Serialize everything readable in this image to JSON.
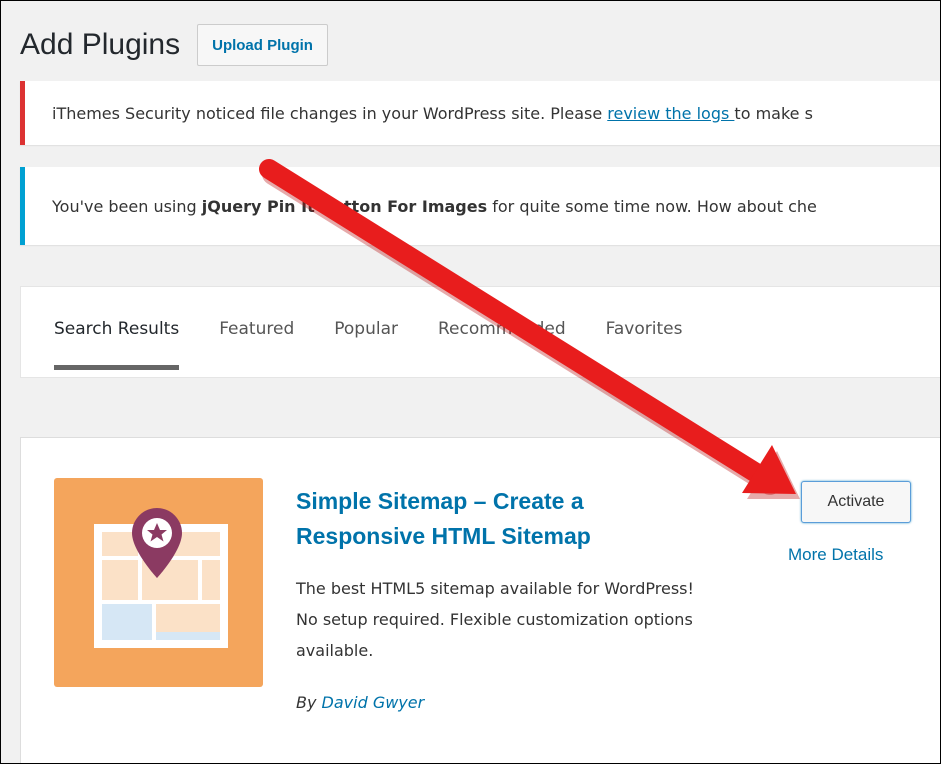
{
  "header": {
    "title": "Add Plugins",
    "upload_label": "Upload Plugin"
  },
  "notices": {
    "security": {
      "before": "iThemes Security noticed file changes in your WordPress site. Please ",
      "link": "review the logs ",
      "after": "to make s"
    },
    "pinit": {
      "before": "You've been using ",
      "plugin": "jQuery Pin It Button For Images",
      "after": " for quite some time now. How about che"
    }
  },
  "tabs": [
    "Search Results",
    "Featured",
    "Popular",
    "Recommended",
    "Favorites"
  ],
  "plugin": {
    "name": "Simple Sitemap – Create a Responsive HTML Sitemap",
    "description": "The best HTML5 sitemap available for WordPress! No setup required. Flexible customization options available.",
    "author_prefix": "By ",
    "author": "David Gwyer",
    "activate_label": "Activate",
    "more_details_label": "More Details",
    "icon": "sitemap-location-pin-icon"
  },
  "colors": {
    "link": "#0073aa",
    "error": "#dc3232",
    "info": "#00a0d2",
    "arrow": "#e81d1d",
    "icon_bg": "#f4a55c",
    "pin": "#8b3a62"
  }
}
